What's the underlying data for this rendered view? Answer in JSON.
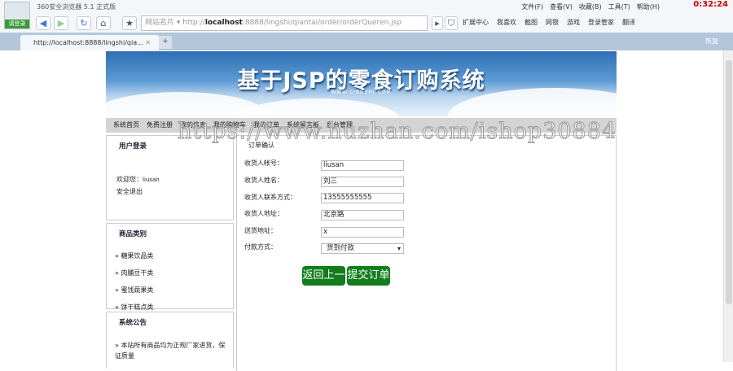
{
  "browser": {
    "title": "360安全浏览器 5.1 正式版",
    "login": "请登录",
    "menus": [
      "文件(F)",
      "查看(V)",
      "收藏(B)",
      "工具(T)",
      "帮助(H)"
    ],
    "clock": "0:32:24",
    "url_prefix": "http://",
    "url_host": "localhost",
    "url_rest": ":8888/lingshi/qiantai/order/orderQueren.jsp",
    "site_name": "网站名片",
    "tools": [
      "扩展中心",
      "我喜欢",
      "截图",
      "网银",
      "游戏",
      "登录管家",
      "翻译"
    ],
    "tab": "http://localhost:8888/lingshi/qia...",
    "restore": "恢复"
  },
  "banner": {
    "title": "基于JSP的零食订购系统",
    "subtitle": "WWW.LINGSHI.COM"
  },
  "nav": [
    "系统首页",
    "免费注册",
    "我的信息",
    "我的购物车",
    "我的订单",
    "系统留言板",
    "后台管理"
  ],
  "login_box": {
    "title": "用户登录",
    "welcome": "欢迎您：",
    "user": "liusan",
    "logout": "安全退出"
  },
  "category_box": {
    "title": "商品类别",
    "items": [
      "» 糖果饮品类",
      "» 肉脯豆干类",
      "» 蜜饯蔬果类",
      "» 饼干糕点类"
    ]
  },
  "notice_box": {
    "title": "系统公告",
    "text": "» 本站所有商品均为正规厂家进货，保证质量"
  },
  "order": {
    "title": "订单确认",
    "fields": [
      {
        "label": "收货人帐号：",
        "value": "liusan"
      },
      {
        "label": "收货人姓名：",
        "value": "刘三"
      },
      {
        "label": "收货人联系方式：",
        "value": "13555555555"
      },
      {
        "label": "收货人地址：",
        "value": "北京路"
      },
      {
        "label": "送货地址：",
        "value": "x"
      }
    ],
    "pay_label": "付款方式：",
    "pay_value": "货到付款",
    "back": "返回上一步",
    "submit": "提交订单"
  },
  "watermark": "https://www.huzhan.com/ishop30884"
}
